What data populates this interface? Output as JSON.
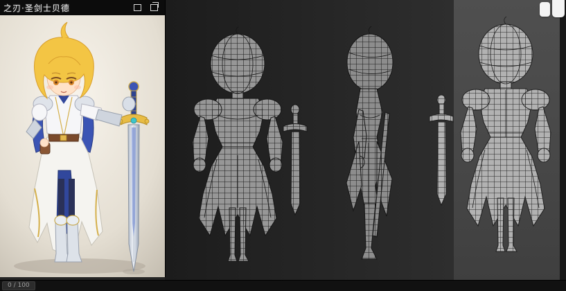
{
  "reference_window": {
    "title": "之刃·圣剑士贝德",
    "controls": [
      {
        "name": "window-restore-icon"
      },
      {
        "name": "window-maximize-icon"
      }
    ],
    "content": "anime knight girl reference illustration"
  },
  "viewport": {
    "models": [
      {
        "name": "knight-wireframe-front"
      },
      {
        "name": "knight-wireframe-side"
      },
      {
        "name": "knight-wireframe-back"
      }
    ]
  },
  "statusbar": {
    "frame_text": "0 / 100"
  },
  "colors": {
    "app_bg": "#242424",
    "viewport_left_bg": "#262626",
    "viewport_right_bg": "#4a4a4a",
    "wireframe_gray": "#979797",
    "hair_gold": "#f3c544",
    "armor_blue": "#31479c",
    "gold_trim": "#d4af4a",
    "blade_silver": "#d7dde6"
  }
}
